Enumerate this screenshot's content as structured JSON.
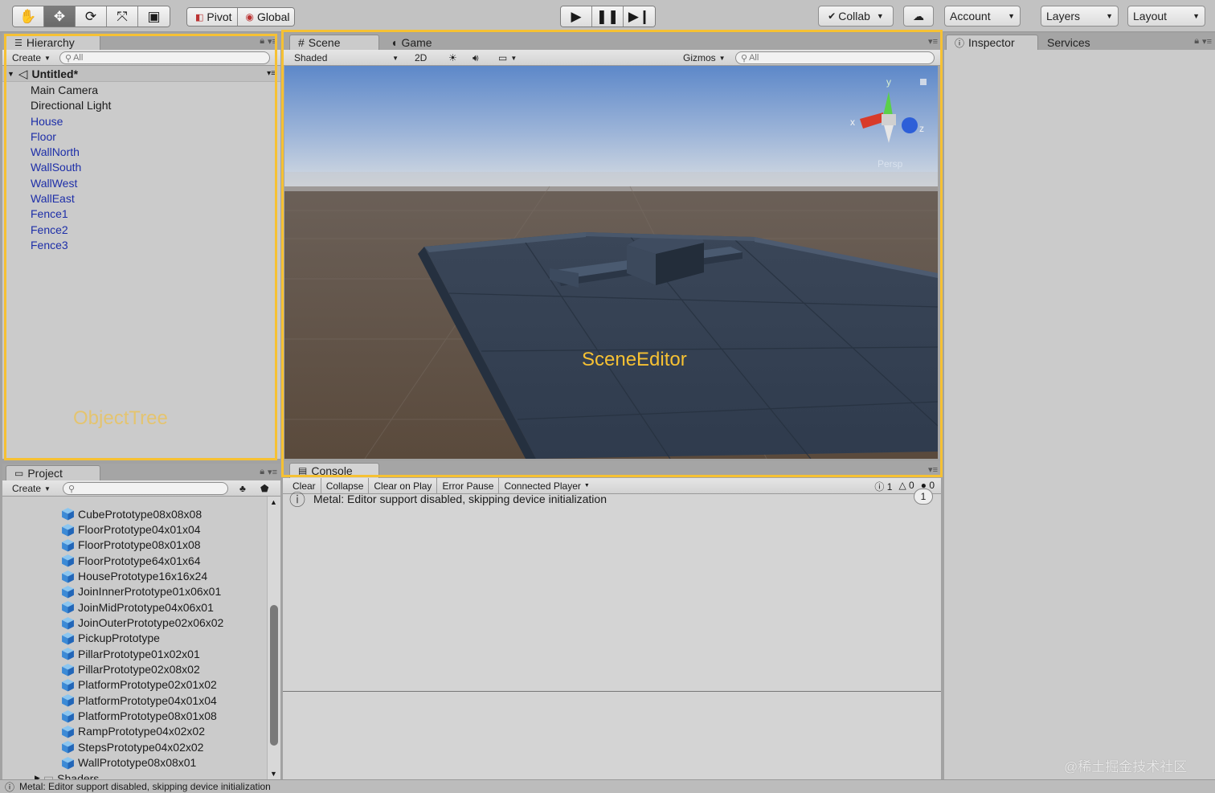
{
  "toolbar": {
    "tools": [
      "hand-tool",
      "move-tool",
      "rotate-tool",
      "scale-tool",
      "rect-tool"
    ],
    "pivot_label": "Pivot",
    "global_label": "Global",
    "collab_label": "Collab",
    "account_label": "Account",
    "layers_label": "Layers",
    "layout_label": "Layout"
  },
  "hierarchy": {
    "tab_label": "Hierarchy",
    "create_label": "Create",
    "search_placeholder": "All",
    "scene_name": "Untitled*",
    "items": [
      {
        "label": "Main Camera",
        "kind": "plain"
      },
      {
        "label": "Directional Light",
        "kind": "plain"
      },
      {
        "label": "House",
        "kind": "obj"
      },
      {
        "label": "Floor",
        "kind": "obj"
      },
      {
        "label": "WallNorth",
        "kind": "obj"
      },
      {
        "label": "WallSouth",
        "kind": "obj"
      },
      {
        "label": "WallWest",
        "kind": "obj"
      },
      {
        "label": "WallEast",
        "kind": "obj"
      },
      {
        "label": "Fence1",
        "kind": "obj"
      },
      {
        "label": "Fence2",
        "kind": "obj"
      },
      {
        "label": "Fence3",
        "kind": "obj"
      }
    ]
  },
  "scene": {
    "tab_scene": "Scene",
    "tab_game": "Game",
    "shading_mode": "Shaded",
    "mode_2d": "2D",
    "gizmos_label": "Gizmos",
    "search_placeholder": "All",
    "persp_label": "Persp",
    "axis_x": "x",
    "axis_y": "y",
    "axis_z": "z"
  },
  "inspector": {
    "tab_inspector": "Inspector",
    "tab_services": "Services"
  },
  "project": {
    "tab_label": "Project",
    "create_label": "Create",
    "items": [
      "CubePrototype08x08x08",
      "FloorPrototype04x01x04",
      "FloorPrototype08x01x08",
      "FloorPrototype64x01x64",
      "HousePrototype16x16x24",
      "JoinInnerPrototype01x06x01",
      "JoinMidPrototype04x06x01",
      "JoinOuterPrototype02x06x02",
      "PickupPrototype",
      "PillarPrototype01x02x01",
      "PillarPrototype02x08x02",
      "PlatformPrototype02x01x02",
      "PlatformPrototype04x01x04",
      "PlatformPrototype08x01x08",
      "RampPrototype04x02x02",
      "StepsPrototype04x02x02",
      "WallPrototype08x08x01"
    ],
    "folder_label": "Shaders"
  },
  "console": {
    "tab_label": "Console",
    "buttons": [
      "Clear",
      "Collapse",
      "Clear on Play",
      "Error Pause",
      "Connected Player"
    ],
    "info_count": "1",
    "warn_count": "0",
    "error_count": "0",
    "message": "Metal: Editor support disabled, skipping device initialization",
    "message_count": "1"
  },
  "annotations": {
    "object_tree": "ObjectTree",
    "scene_editor": "SceneEditor"
  },
  "status_bar": {
    "message": "Metal: Editor support disabled, skipping device initialization"
  },
  "watermark": "@稀土掘金技术社区"
}
